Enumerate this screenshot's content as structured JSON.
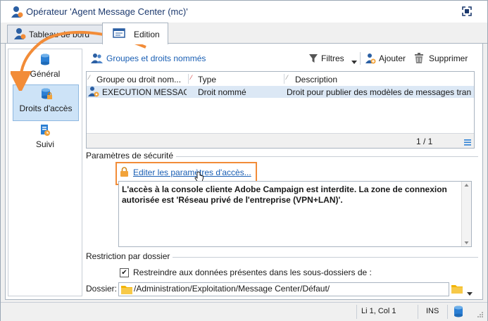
{
  "window": {
    "title": "Opérateur 'Agent Message Center (mc)'"
  },
  "tabs": [
    {
      "label": "Tableau de bord",
      "active": false
    },
    {
      "label": "Edition",
      "active": true
    }
  ],
  "sidebar": {
    "items": [
      {
        "label": "Général",
        "icon": "database-icon",
        "selected": false
      },
      {
        "label": "Droits d'accès",
        "icon": "database-lock-icon",
        "selected": true
      },
      {
        "label": "Suivi",
        "icon": "document-clock-icon",
        "selected": false
      }
    ]
  },
  "toolbar": {
    "section_title": "Groupes et droits nommés",
    "filters_label": "Filtres",
    "add_label": "Ajouter",
    "delete_label": "Supprimer"
  },
  "grid": {
    "columns": [
      "Groupe ou droit nom...",
      "Type",
      "Description"
    ],
    "rows": [
      {
        "name": "EXECUTION MESSAG...",
        "type": "Droit nommé",
        "description": "Droit pour publier des modèles de messages trans..."
      }
    ],
    "pagination": "1 / 1"
  },
  "security": {
    "section_label": "Paramètres de sécurité",
    "edit_link": "Editer les paramètres d'accès...",
    "description": "L'accès à la console cliente Adobe Campaign est interdite. La zone de connexion autorisée est 'Réseau privé de l'entreprise (VPN+LAN)'."
  },
  "folder_restriction": {
    "section_label": "Restriction par dossier",
    "checkbox_label": "Restreindre aux données présentes dans les sous-dossiers de :",
    "checkbox_checked": true,
    "folder_label": "Dossier:",
    "folder_value": "/Administration/Exploitation/Message Center/Défaut/"
  },
  "statusbar": {
    "position": "Li 1, Col 1",
    "mode": "INS"
  },
  "colors": {
    "accent_orange": "#f28c38",
    "link_blue": "#1a5fb4",
    "selection_blue": "#cde3f7"
  }
}
